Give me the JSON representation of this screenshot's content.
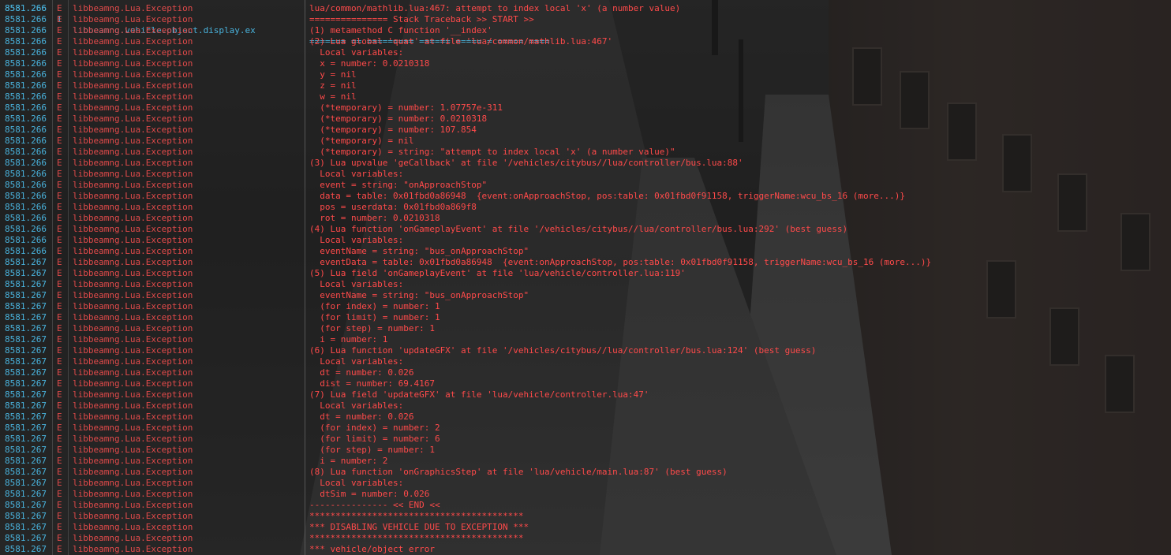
{
  "console": {
    "top_row": {
      "time": "8581.266",
      "level": "I",
      "origin": "libbeamng.vehicle.object.display.ex",
      "message": "======= == ========= ====== ===== = ===== ===="
    },
    "rows": [
      {
        "time": "8581.266",
        "level": "E",
        "origin": "libbeamng.Lua.Exception",
        "message": "lua/common/mathlib.lua:467: attempt to index local 'x' (a number value)"
      },
      {
        "time": "8581.266",
        "level": "E",
        "origin": "libbeamng.Lua.Exception",
        "message": "=============== Stack Traceback >> START >>"
      },
      {
        "time": "8581.266",
        "level": "E",
        "origin": "libbeamng.Lua.Exception",
        "message": "(1) metamethod C function '__index'"
      },
      {
        "time": "8581.266",
        "level": "E",
        "origin": "libbeamng.Lua.Exception",
        "message": "(2) Lua global 'quat' at file 'lua/common/mathlib.lua:467'"
      },
      {
        "time": "8581.266",
        "level": "E",
        "origin": "libbeamng.Lua.Exception",
        "message": "  Local variables:"
      },
      {
        "time": "8581.266",
        "level": "E",
        "origin": "libbeamng.Lua.Exception",
        "message": "  x = number: 0.0210318"
      },
      {
        "time": "8581.266",
        "level": "E",
        "origin": "libbeamng.Lua.Exception",
        "message": "  y = nil"
      },
      {
        "time": "8581.266",
        "level": "E",
        "origin": "libbeamng.Lua.Exception",
        "message": "  z = nil"
      },
      {
        "time": "8581.266",
        "level": "E",
        "origin": "libbeamng.Lua.Exception",
        "message": "  w = nil"
      },
      {
        "time": "8581.266",
        "level": "E",
        "origin": "libbeamng.Lua.Exception",
        "message": "  (*temporary) = number: 1.07757e-311"
      },
      {
        "time": "8581.266",
        "level": "E",
        "origin": "libbeamng.Lua.Exception",
        "message": "  (*temporary) = number: 0.0210318"
      },
      {
        "time": "8581.266",
        "level": "E",
        "origin": "libbeamng.Lua.Exception",
        "message": "  (*temporary) = number: 107.854"
      },
      {
        "time": "8581.266",
        "level": "E",
        "origin": "libbeamng.Lua.Exception",
        "message": "  (*temporary) = nil"
      },
      {
        "time": "8581.266",
        "level": "E",
        "origin": "libbeamng.Lua.Exception",
        "message": "  (*temporary) = string: \"attempt to index local 'x' (a number value)\""
      },
      {
        "time": "8581.266",
        "level": "E",
        "origin": "libbeamng.Lua.Exception",
        "message": "(3) Lua upvalue 'geCallback' at file '/vehicles/citybus//lua/controller/bus.lua:88'"
      },
      {
        "time": "8581.266",
        "level": "E",
        "origin": "libbeamng.Lua.Exception",
        "message": "  Local variables:"
      },
      {
        "time": "8581.266",
        "level": "E",
        "origin": "libbeamng.Lua.Exception",
        "message": "  event = string: \"onApproachStop\""
      },
      {
        "time": "8581.266",
        "level": "E",
        "origin": "libbeamng.Lua.Exception",
        "message": "  data = table: 0x01fbd0a86948  {event:onApproachStop, pos:table: 0x01fbd0f91158, triggerName:wcu_bs_16 (more...)}"
      },
      {
        "time": "8581.266",
        "level": "E",
        "origin": "libbeamng.Lua.Exception",
        "message": "  pos = userdata: 0x01fbd0a869f8"
      },
      {
        "time": "8581.266",
        "level": "E",
        "origin": "libbeamng.Lua.Exception",
        "message": "  rot = number: 0.0210318"
      },
      {
        "time": "8581.266",
        "level": "E",
        "origin": "libbeamng.Lua.Exception",
        "message": "(4) Lua function 'onGameplayEvent' at file '/vehicles/citybus//lua/controller/bus.lua:292' (best guess)"
      },
      {
        "time": "8581.266",
        "level": "E",
        "origin": "libbeamng.Lua.Exception",
        "message": "  Local variables:"
      },
      {
        "time": "8581.266",
        "level": "E",
        "origin": "libbeamng.Lua.Exception",
        "message": "  eventName = string: \"bus_onApproachStop\""
      },
      {
        "time": "8581.267",
        "level": "E",
        "origin": "libbeamng.Lua.Exception",
        "message": "  eventData = table: 0x01fbd0a86948  {event:onApproachStop, pos:table: 0x01fbd0f91158, triggerName:wcu_bs_16 (more...)}"
      },
      {
        "time": "8581.267",
        "level": "E",
        "origin": "libbeamng.Lua.Exception",
        "message": "(5) Lua field 'onGameplayEvent' at file 'lua/vehicle/controller.lua:119'"
      },
      {
        "time": "8581.267",
        "level": "E",
        "origin": "libbeamng.Lua.Exception",
        "message": "  Local variables:"
      },
      {
        "time": "8581.267",
        "level": "E",
        "origin": "libbeamng.Lua.Exception",
        "message": "  eventName = string: \"bus_onApproachStop\""
      },
      {
        "time": "8581.267",
        "level": "E",
        "origin": "libbeamng.Lua.Exception",
        "message": "  (for index) = number: 1"
      },
      {
        "time": "8581.267",
        "level": "E",
        "origin": "libbeamng.Lua.Exception",
        "message": "  (for limit) = number: 1"
      },
      {
        "time": "8581.267",
        "level": "E",
        "origin": "libbeamng.Lua.Exception",
        "message": "  (for step) = number: 1"
      },
      {
        "time": "8581.267",
        "level": "E",
        "origin": "libbeamng.Lua.Exception",
        "message": "  i = number: 1"
      },
      {
        "time": "8581.267",
        "level": "E",
        "origin": "libbeamng.Lua.Exception",
        "message": "(6) Lua function 'updateGFX' at file '/vehicles/citybus//lua/controller/bus.lua:124' (best guess)"
      },
      {
        "time": "8581.267",
        "level": "E",
        "origin": "libbeamng.Lua.Exception",
        "message": "  Local variables:"
      },
      {
        "time": "8581.267",
        "level": "E",
        "origin": "libbeamng.Lua.Exception",
        "message": "  dt = number: 0.026"
      },
      {
        "time": "8581.267",
        "level": "E",
        "origin": "libbeamng.Lua.Exception",
        "message": "  dist = number: 69.4167"
      },
      {
        "time": "8581.267",
        "level": "E",
        "origin": "libbeamng.Lua.Exception",
        "message": "(7) Lua field 'updateGFX' at file 'lua/vehicle/controller.lua:47'"
      },
      {
        "time": "8581.267",
        "level": "E",
        "origin": "libbeamng.Lua.Exception",
        "message": "  Local variables:"
      },
      {
        "time": "8581.267",
        "level": "E",
        "origin": "libbeamng.Lua.Exception",
        "message": "  dt = number: 0.026"
      },
      {
        "time": "8581.267",
        "level": "E",
        "origin": "libbeamng.Lua.Exception",
        "message": "  (for index) = number: 2"
      },
      {
        "time": "8581.267",
        "level": "E",
        "origin": "libbeamng.Lua.Exception",
        "message": "  (for limit) = number: 6"
      },
      {
        "time": "8581.267",
        "level": "E",
        "origin": "libbeamng.Lua.Exception",
        "message": "  (for step) = number: 1"
      },
      {
        "time": "8581.267",
        "level": "E",
        "origin": "libbeamng.Lua.Exception",
        "message": "  i = number: 2"
      },
      {
        "time": "8581.267",
        "level": "E",
        "origin": "libbeamng.Lua.Exception",
        "message": "(8) Lua function 'onGraphicsStep' at file 'lua/vehicle/main.lua:87' (best guess)"
      },
      {
        "time": "8581.267",
        "level": "E",
        "origin": "libbeamng.Lua.Exception",
        "message": "  Local variables:"
      },
      {
        "time": "8581.267",
        "level": "E",
        "origin": "libbeamng.Lua.Exception",
        "message": "  dtSim = number: 0.026"
      },
      {
        "time": "8581.267",
        "level": "E",
        "origin": "libbeamng.Lua.Exception",
        "message": "--------------- << END <<"
      },
      {
        "time": "8581.267",
        "level": "E",
        "origin": "libbeamng.Lua.Exception",
        "message": "*****************************************"
      },
      {
        "time": "8581.267",
        "level": "E",
        "origin": "libbeamng.Lua.Exception",
        "message": "*** DISABLING VEHICLE DUE TO EXCEPTION ***"
      },
      {
        "time": "8581.267",
        "level": "E",
        "origin": "libbeamng.Lua.Exception",
        "message": "*****************************************"
      },
      {
        "time": "8581.267",
        "level": "E",
        "origin": "libbeamng.Lua.Exception",
        "message": "*** vehicle/object error"
      }
    ]
  },
  "colors": {
    "timestamp": "#49b3dd",
    "error": "#ff4a4a"
  }
}
